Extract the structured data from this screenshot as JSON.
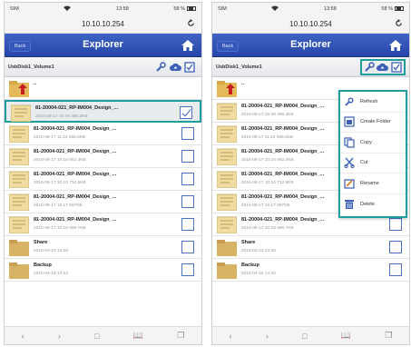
{
  "status": {
    "carrier": "SIM",
    "time": "13:58",
    "battery": "58 %"
  },
  "browser": {
    "url": "10.10.10.254",
    "reload_icon": "reload-icon"
  },
  "nav": {
    "back": "Back",
    "title": "Explorer",
    "home_icon": "home-icon"
  },
  "path": "UsbDisk1_Volume1",
  "toolbar": {
    "icons": [
      "wrench-icon",
      "upload-icon",
      "select-checkbox-icon"
    ]
  },
  "rows": [
    {
      "type": "up",
      "name": "..",
      "meta": ""
    },
    {
      "name": "81-20004-021_RP-IM004_Design_...",
      "meta": "2016-08-17 10:49 486.3KB"
    },
    {
      "name": "81-20004-021_RP-IM004_Design_...",
      "meta": "2016-08-17 11:24 665.6KB"
    },
    {
      "name": "81-20004-021_RP-IM004_Design_...",
      "meta": "2016-08-17 10:15 662.4KB"
    },
    {
      "name": "81-20004-021_RP-IM004_Design_...",
      "meta": "2016-08-17 10:10 712.8KB"
    },
    {
      "name": "81-20004-021_RP-IM004_Design_...",
      "meta": "2016-08-17 10:17 687KB"
    },
    {
      "name": "81-20004-021_RP-IM004_Design_...",
      "meta": "2016-08-17 10:16 596.7KB"
    },
    {
      "type": "folder",
      "name": "Share",
      "meta": "2016-03-23 13:58"
    },
    {
      "type": "folder",
      "name": "Backup",
      "meta": "2016-04-16 14:33"
    }
  ],
  "menu": {
    "refresh": "Refresh",
    "create_folder": "Create Folder",
    "copy": "Copy",
    "cut": "Cut",
    "rename": "Rename",
    "delete": "Delete"
  },
  "colors": {
    "nav": "#2e4fb5",
    "highlight": "#1e9e9e",
    "check_border": "#4a6fc5"
  }
}
